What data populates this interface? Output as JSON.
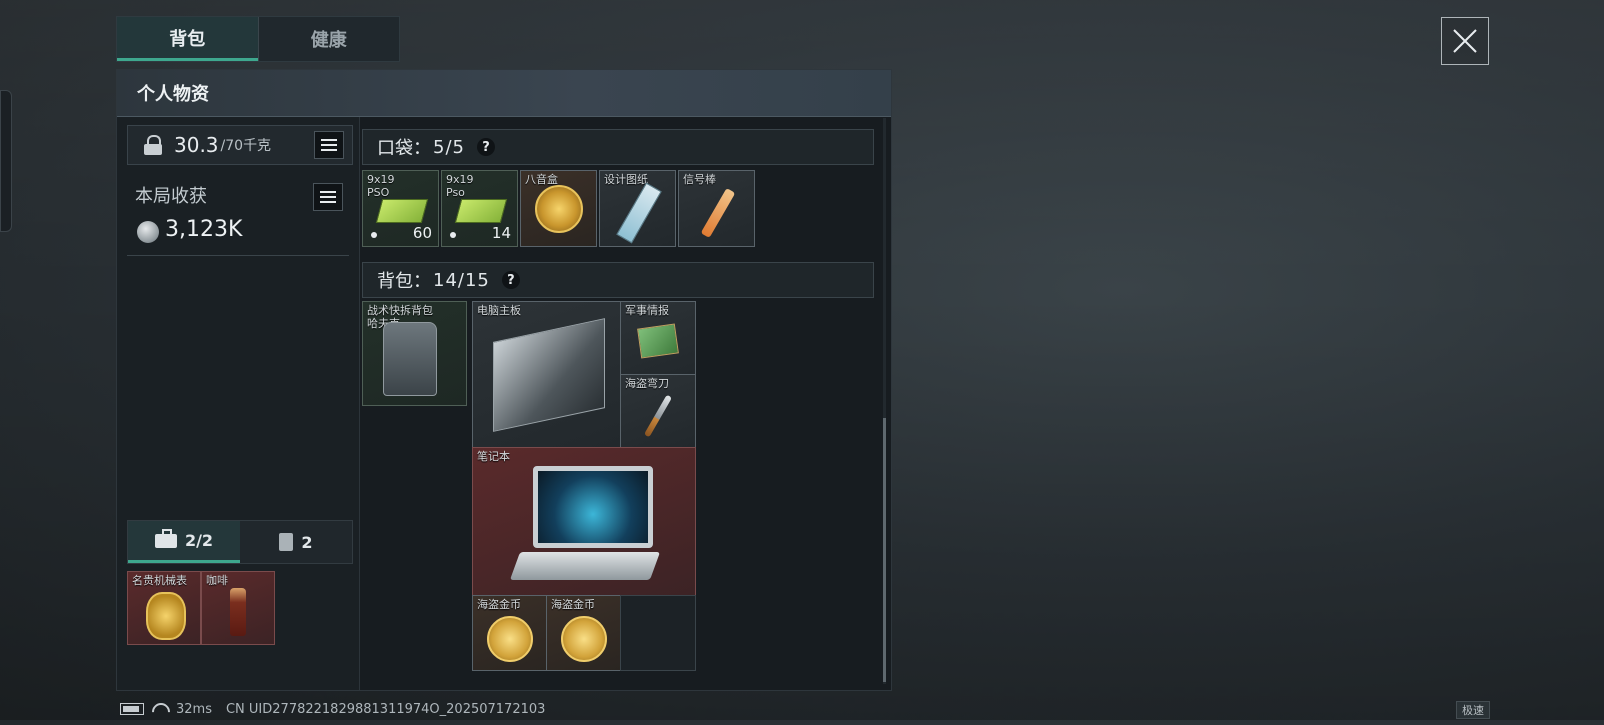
{
  "top_tabs": [
    {
      "label": "背包",
      "active": true
    },
    {
      "label": "健康",
      "active": false
    }
  ],
  "panel": {
    "title": "个人物资",
    "weight": {
      "current": "30.3",
      "max": "/70千克"
    },
    "harvest": {
      "label": "本局收获",
      "value": "3,123K"
    },
    "sub_tabs": [
      {
        "label": "2/2",
        "icon": "briefcase-icon"
      },
      {
        "label": "2",
        "icon": "canister-icon"
      }
    ],
    "safe_items": [
      {
        "name": "名贵机械表",
        "art": "watch"
      },
      {
        "name": "咖啡",
        "art": "bottle"
      }
    ]
  },
  "pocket": {
    "label": "口袋：",
    "count": "5/5",
    "help": "?",
    "items": [
      {
        "name": "9x19\nPSO",
        "count": "60",
        "art": "ammo"
      },
      {
        "name": "9x19\nPso",
        "count": "14",
        "art": "ammo"
      },
      {
        "name": "八音盒",
        "count": "",
        "art": "ring"
      },
      {
        "name": "设计图纸",
        "count": "",
        "art": "blueprint"
      },
      {
        "name": "信号棒",
        "count": "",
        "art": "flare"
      }
    ]
  },
  "backpack": {
    "label": "背包：",
    "count": "14/15",
    "help": "?",
    "equipped": {
      "name": "战术快拆背包\n哈夫克",
      "art": "backpack"
    },
    "items": [
      {
        "name": "电脑主板",
        "art": "board"
      },
      {
        "name": "军事情报",
        "art": "chip"
      },
      {
        "name": "海盗弯刀",
        "art": "knife"
      },
      {
        "name": "笔记本",
        "art": "laptop"
      },
      {
        "name": "海盗金币",
        "art": "coin"
      },
      {
        "name": "海盗金币",
        "art": "coin"
      }
    ]
  },
  "status": {
    "ping": "32ms",
    "uid": "CN UID2778221829881311974O_202507172103",
    "speed_badge": "极速"
  },
  "colors": {
    "accent": "#3ea88e",
    "panel_bg": "#171c20",
    "rare_red": "#5a2a2b",
    "gold": "#d2a33a"
  }
}
